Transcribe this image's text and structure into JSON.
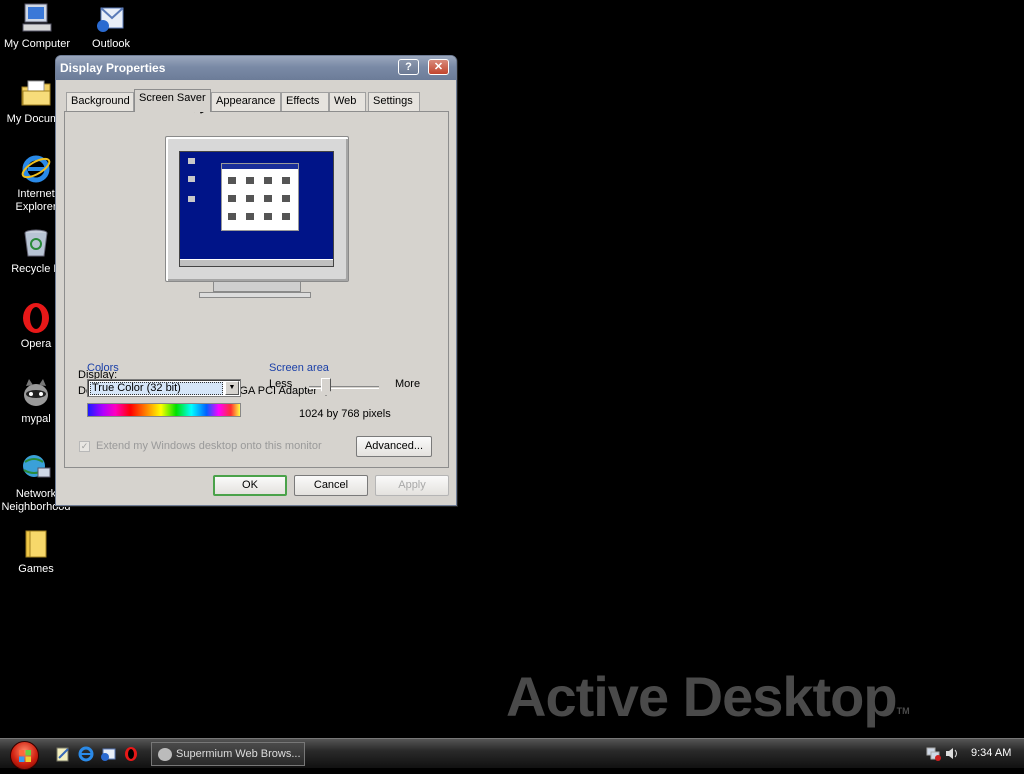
{
  "desktop": {
    "icons": [
      {
        "label": "My Computer",
        "icon": "computer-icon"
      },
      {
        "label": "Outlook",
        "icon": "outlook-icon"
      },
      {
        "label": "My Docume",
        "icon": "folder-documents-icon"
      },
      {
        "label": "Internet\nExplorer",
        "icon": "internet-explorer-icon"
      },
      {
        "label": "Recycle B",
        "icon": "recycle-bin-icon"
      },
      {
        "label": "Opera",
        "icon": "opera-icon"
      },
      {
        "label": "mypal",
        "icon": "mypal-icon"
      },
      {
        "label": "Network\nNeighborhood",
        "icon": "network-icon"
      },
      {
        "label": "Games",
        "icon": "folder-icon"
      }
    ],
    "watermark": "Active Desktop",
    "watermark_tm": "TM"
  },
  "dialog": {
    "title": "Display Properties",
    "help_label": "?",
    "close_label": "✕",
    "tabs": [
      {
        "label": "Background",
        "active": false
      },
      {
        "label": "Screen Saver",
        "active": true
      },
      {
        "label": "Appearance",
        "active": false
      },
      {
        "label": "Effects",
        "active": false
      },
      {
        "label": "Web",
        "active": false
      },
      {
        "label": "Settings",
        "active": false
      }
    ],
    "display_label": "Display:",
    "display_value": "Default Monitor on QEMU STD VGA PCI Adapter",
    "colors": {
      "title": "Colors",
      "selected": "True Color (32 bit)"
    },
    "screen_area": {
      "title": "Screen area",
      "less_label": "Less",
      "more_label": "More",
      "resolution": "1024 by 768 pixels"
    },
    "extend_checkbox_label": "Extend my Windows desktop onto this monitor",
    "advanced_button": "Advanced...",
    "ok_button": "OK",
    "cancel_button": "Cancel",
    "apply_button": "Apply"
  },
  "taskbar": {
    "task_button": "Supermium Web Brows...",
    "clock": "9:34 AM"
  },
  "colors": {
    "accent_blue": "#1a3fa8",
    "desktop_bg": "#000000",
    "dialog_bg": "#d6d3ce",
    "default_button_border": "#4aa24a"
  }
}
